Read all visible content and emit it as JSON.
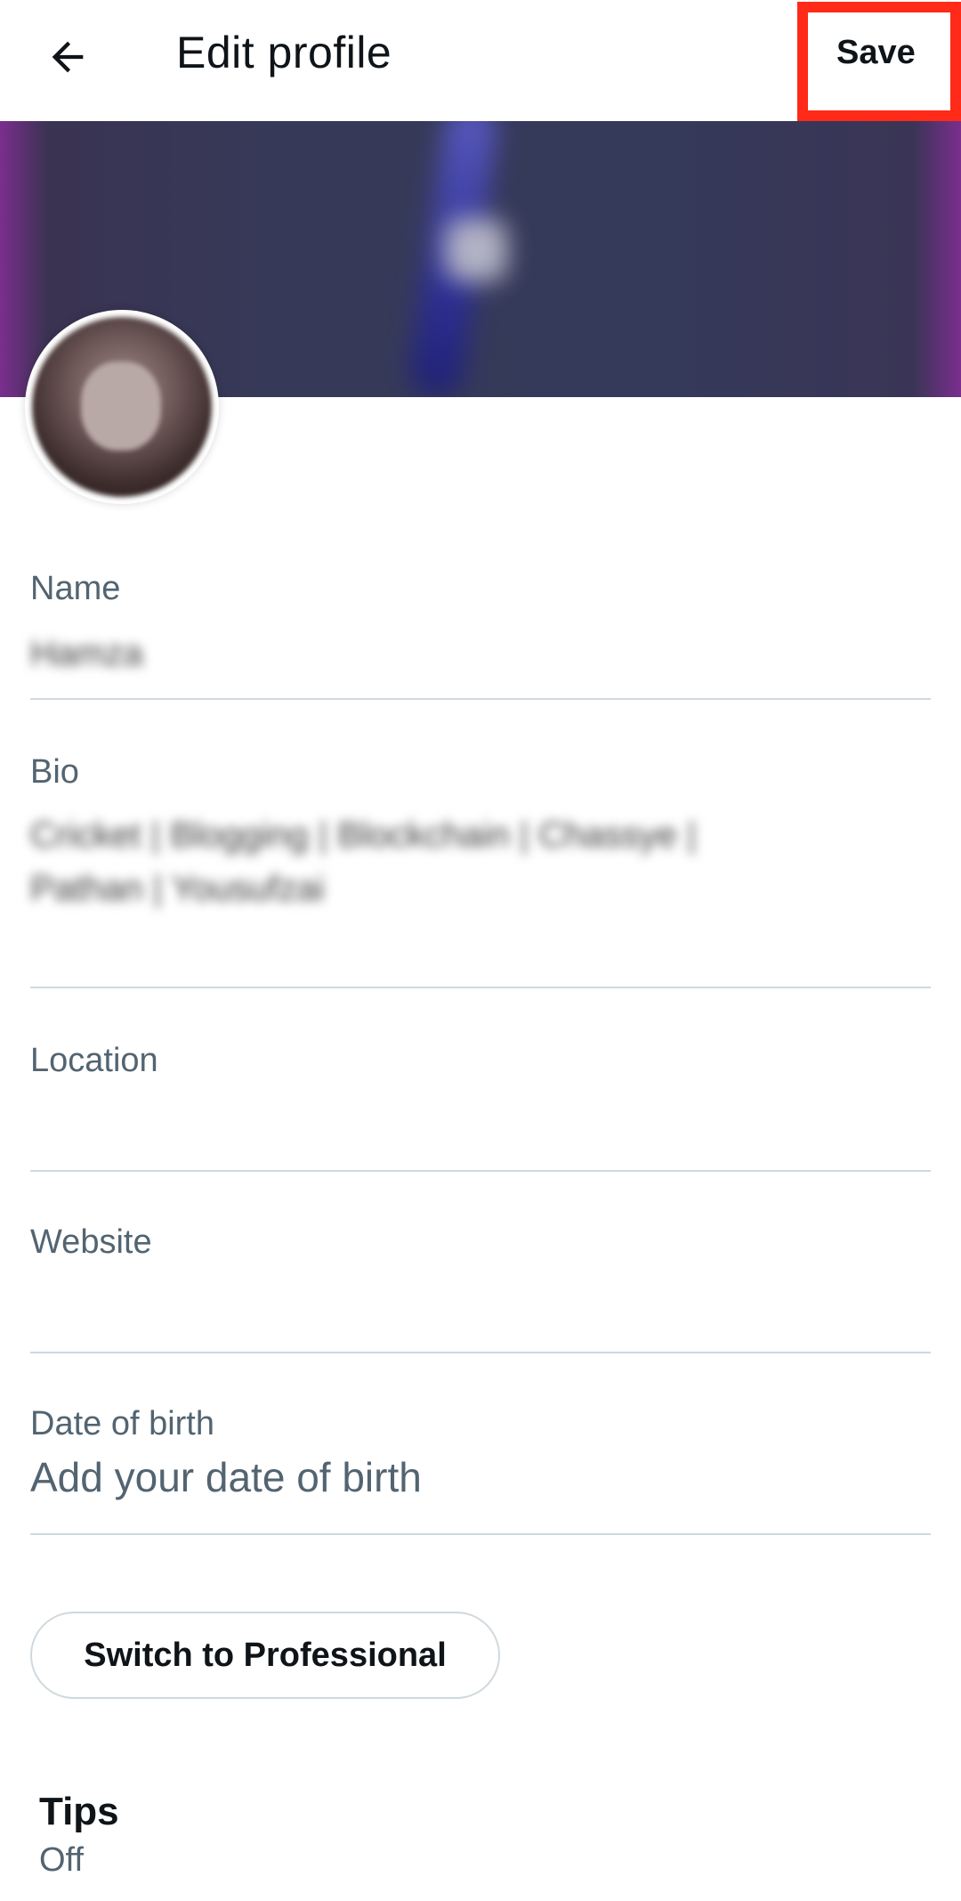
{
  "header": {
    "title": "Edit profile",
    "save_label": "Save",
    "highlight_color": "#ff2a17"
  },
  "profile": {
    "name_label": "Name",
    "name_value": "Hamza",
    "bio_label": "Bio",
    "bio_value_line1": "Cricket | Blogging | Blockchain | Chassye |",
    "bio_value_line2": "Pathan | Yousufzai",
    "location_label": "Location",
    "website_label": "Website",
    "dob_label": "Date of birth",
    "dob_placeholder": "Add your date of birth"
  },
  "actions": {
    "switch_professional_label": "Switch to Professional"
  },
  "tips": {
    "title": "Tips",
    "status": "Off"
  },
  "icons": {
    "back": "back-arrow-icon"
  }
}
